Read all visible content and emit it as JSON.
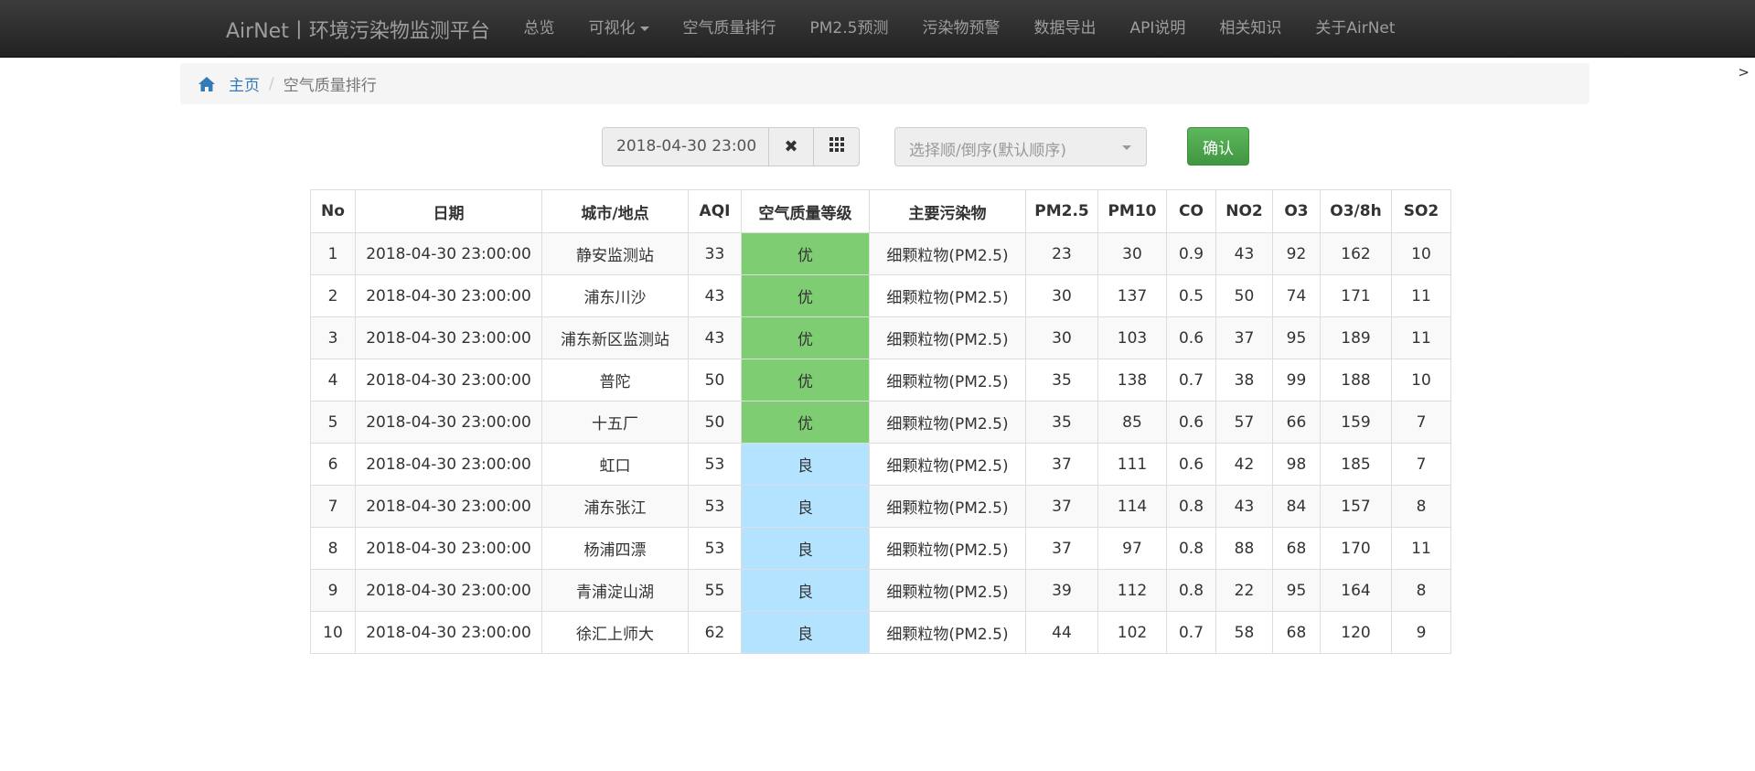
{
  "navbar": {
    "brand": "AirNet丨环境污染物监测平台",
    "items": [
      {
        "label": "总览"
      },
      {
        "label": "可视化"
      },
      {
        "label": "空气质量排行"
      },
      {
        "label": "PM2.5预测"
      },
      {
        "label": "污染物预警"
      },
      {
        "label": "数据导出"
      },
      {
        "label": "API说明"
      },
      {
        "label": "相关知识"
      },
      {
        "label": "关于AirNet"
      }
    ],
    "corner_mark": ">"
  },
  "breadcrumb": {
    "home_icon": "home-icon",
    "home": "主页",
    "separator": "/",
    "current": "空气质量排行"
  },
  "toolbar": {
    "date_value": "2018-04-30 23:00",
    "clear_icon": "✖",
    "calendar_icon": "grid-icon",
    "order_placeholder": "选择顺/倒序(默认顺序)",
    "confirm_label": "确认",
    "confirm_color": "#5cb85c"
  },
  "table": {
    "headers": [
      "No",
      "日期",
      "城市/地点",
      "AQI",
      "空气质量等级",
      "主要污染物",
      "PM2.5",
      "PM10",
      "CO",
      "NO2",
      "O3",
      "O3/8h",
      "SO2"
    ],
    "level_colors": {
      "优": "#7fcd73",
      "良": "#b3e3ff"
    },
    "rows": [
      [
        "1",
        "2018-04-30 23:00:00",
        "静安监测站",
        "33",
        "优",
        "细颗粒物(PM2.5)",
        "23",
        "30",
        "0.9",
        "43",
        "92",
        "162",
        "10"
      ],
      [
        "2",
        "2018-04-30 23:00:00",
        "浦东川沙",
        "43",
        "优",
        "细颗粒物(PM2.5)",
        "30",
        "137",
        "0.5",
        "50",
        "74",
        "171",
        "11"
      ],
      [
        "3",
        "2018-04-30 23:00:00",
        "浦东新区监测站",
        "43",
        "优",
        "细颗粒物(PM2.5)",
        "30",
        "103",
        "0.6",
        "37",
        "95",
        "189",
        "11"
      ],
      [
        "4",
        "2018-04-30 23:00:00",
        "普陀",
        "50",
        "优",
        "细颗粒物(PM2.5)",
        "35",
        "138",
        "0.7",
        "38",
        "99",
        "188",
        "10"
      ],
      [
        "5",
        "2018-04-30 23:00:00",
        "十五厂",
        "50",
        "优",
        "细颗粒物(PM2.5)",
        "35",
        "85",
        "0.6",
        "57",
        "66",
        "159",
        "7"
      ],
      [
        "6",
        "2018-04-30 23:00:00",
        "虹口",
        "53",
        "良",
        "细颗粒物(PM2.5)",
        "37",
        "111",
        "0.6",
        "42",
        "98",
        "185",
        "7"
      ],
      [
        "7",
        "2018-04-30 23:00:00",
        "浦东张江",
        "53",
        "良",
        "细颗粒物(PM2.5)",
        "37",
        "114",
        "0.8",
        "43",
        "84",
        "157",
        "8"
      ],
      [
        "8",
        "2018-04-30 23:00:00",
        "杨浦四漂",
        "53",
        "良",
        "细颗粒物(PM2.5)",
        "37",
        "97",
        "0.8",
        "88",
        "68",
        "170",
        "11"
      ],
      [
        "9",
        "2018-04-30 23:00:00",
        "青浦淀山湖",
        "55",
        "良",
        "细颗粒物(PM2.5)",
        "39",
        "112",
        "0.8",
        "22",
        "95",
        "164",
        "8"
      ],
      [
        "10",
        "2018-04-30 23:00:00",
        "徐汇上师大",
        "62",
        "良",
        "细颗粒物(PM2.5)",
        "44",
        "102",
        "0.7",
        "58",
        "68",
        "120",
        "9"
      ]
    ]
  }
}
